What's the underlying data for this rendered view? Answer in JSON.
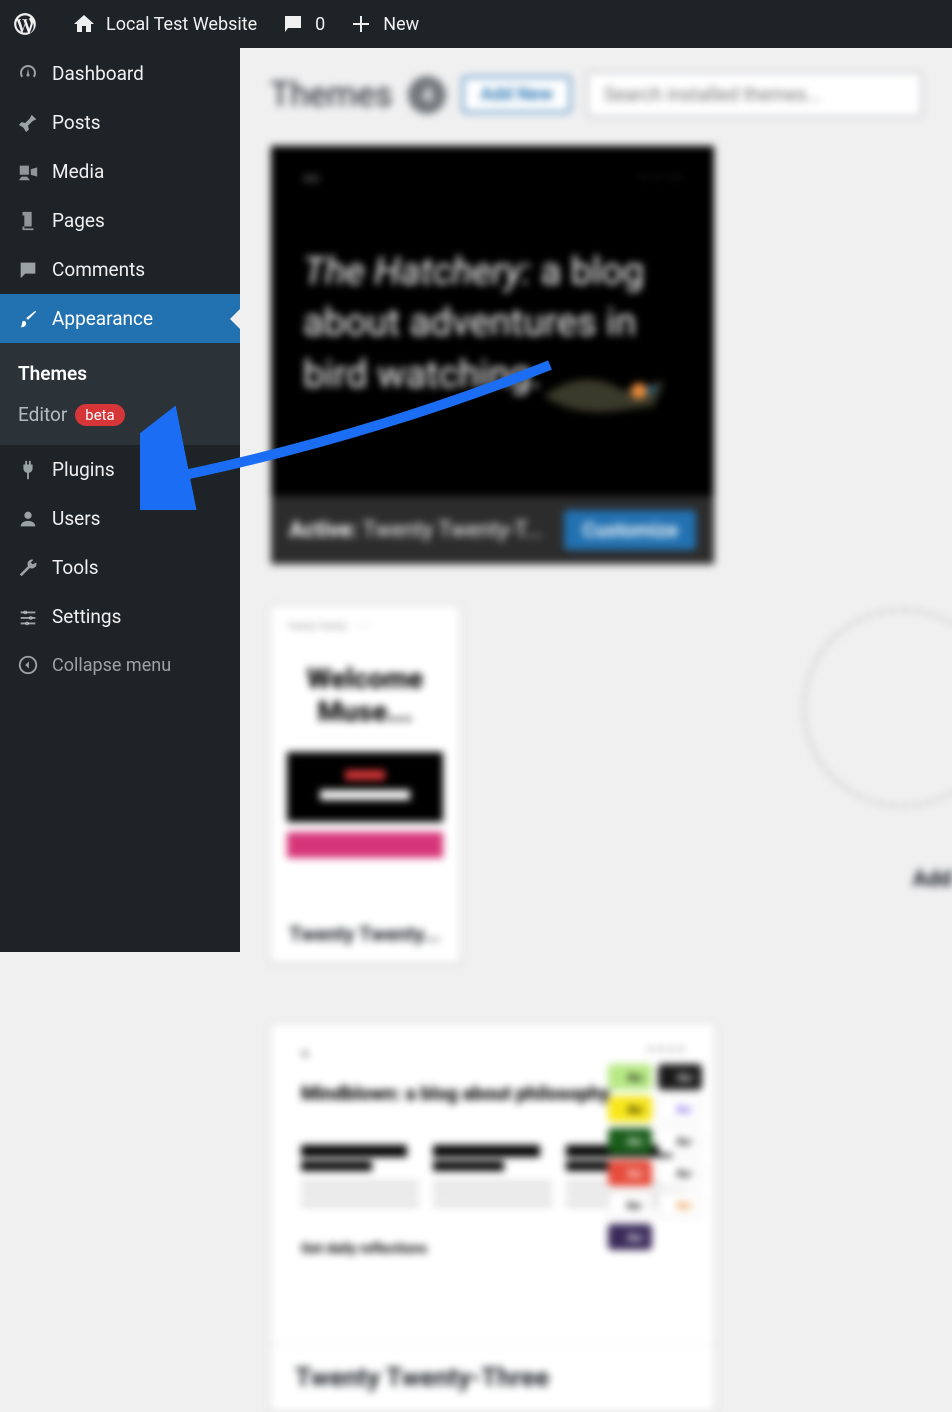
{
  "adminbar": {
    "site_name": "Local Test Website",
    "comments_count": "0",
    "new_label": "New"
  },
  "sidebar": {
    "dashboard": "Dashboard",
    "posts": "Posts",
    "media": "Media",
    "pages": "Pages",
    "comments": "Comments",
    "appearance": "Appearance",
    "submenu": {
      "themes": "Themes",
      "editor": "Editor",
      "editor_badge": "beta"
    },
    "plugins": "Plugins",
    "users": "Users",
    "tools": "Tools",
    "settings": "Settings",
    "collapse": "Collapse menu"
  },
  "content": {
    "title": "Themes",
    "count": "4",
    "add_new": "Add New",
    "search_placeholder": "Search installed themes...",
    "theme1": {
      "preview_title_italic": "The Hatchery:",
      "preview_title_rest": " a blog about adventures in bird watching.",
      "active_prefix": "Active:",
      "active_name": "Twenty Twenty-T...",
      "customize": "Customize"
    },
    "theme2": {
      "welcome": "Welcome Muse...",
      "name": "Twenty Twenty..."
    },
    "theme3": {
      "mini_headline": "Mindblown: a blog about philosophy.",
      "name": "Twenty Twenty-Three"
    },
    "theme4": {
      "add_label": "Add"
    }
  }
}
